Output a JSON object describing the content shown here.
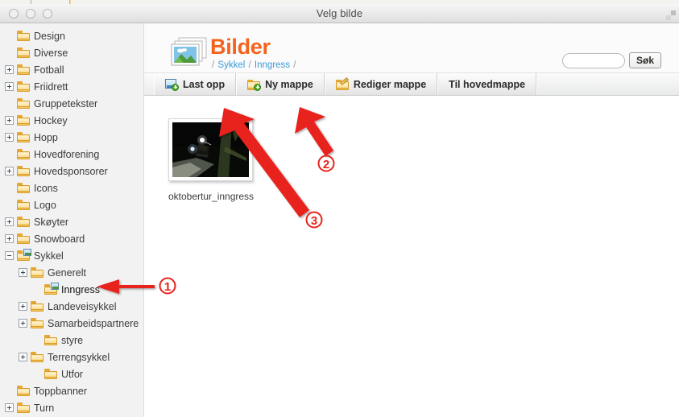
{
  "window": {
    "title": "Velg bilde",
    "controls": [
      "close",
      "minimize",
      "zoom"
    ],
    "resize_grip_icon": "resize-grip-icon"
  },
  "sidebar": {
    "items": [
      {
        "label": "Design",
        "indent": 1,
        "toggle": "none",
        "icon": "folder-icon"
      },
      {
        "label": "Diverse",
        "indent": 1,
        "toggle": "none",
        "icon": "folder-icon"
      },
      {
        "label": "Fotball",
        "indent": 1,
        "toggle": "plus",
        "icon": "folder-icon"
      },
      {
        "label": "Friidrett",
        "indent": 1,
        "toggle": "plus",
        "icon": "folder-icon"
      },
      {
        "label": "Gruppetekster",
        "indent": 1,
        "toggle": "none",
        "icon": "folder-icon"
      },
      {
        "label": "Hockey",
        "indent": 1,
        "toggle": "plus",
        "icon": "folder-icon"
      },
      {
        "label": "Hopp",
        "indent": 1,
        "toggle": "plus",
        "icon": "folder-icon"
      },
      {
        "label": "Hovedforening",
        "indent": 1,
        "toggle": "none",
        "icon": "folder-icon"
      },
      {
        "label": "Hovedsponsorer",
        "indent": 1,
        "toggle": "plus",
        "icon": "folder-icon"
      },
      {
        "label": "Icons",
        "indent": 1,
        "toggle": "none",
        "icon": "folder-icon"
      },
      {
        "label": "Logo",
        "indent": 1,
        "toggle": "none",
        "icon": "folder-icon"
      },
      {
        "label": "Skøyter",
        "indent": 1,
        "toggle": "plus",
        "icon": "folder-icon"
      },
      {
        "label": "Snowboard",
        "indent": 1,
        "toggle": "plus",
        "icon": "folder-icon"
      },
      {
        "label": "Sykkel",
        "indent": 1,
        "toggle": "minus",
        "icon": "folder-image-icon"
      },
      {
        "label": "Generelt",
        "indent": 2,
        "toggle": "plus",
        "icon": "folder-icon"
      },
      {
        "label": "Inngress",
        "indent": 3,
        "toggle": "none",
        "icon": "folder-image-icon",
        "selected": true
      },
      {
        "label": "Landeveisykkel",
        "indent": 2,
        "toggle": "plus",
        "icon": "folder-icon"
      },
      {
        "label": "Samarbeidspartnere",
        "indent": 2,
        "toggle": "plus",
        "icon": "folder-icon"
      },
      {
        "label": "styre",
        "indent": 3,
        "toggle": "none",
        "icon": "folder-icon"
      },
      {
        "label": "Terrengsykkel",
        "indent": 2,
        "toggle": "plus",
        "icon": "folder-icon"
      },
      {
        "label": "Utfor",
        "indent": 3,
        "toggle": "none",
        "icon": "folder-icon"
      },
      {
        "label": "Toppbanner",
        "indent": 1,
        "toggle": "none",
        "icon": "folder-icon"
      },
      {
        "label": "Turn",
        "indent": 1,
        "toggle": "plus",
        "icon": "folder-icon"
      }
    ]
  },
  "header": {
    "title": "Bilder",
    "title_color": "#f4631e",
    "icon": "pictures-icon",
    "breadcrumb": {
      "sep": "/",
      "crumbs": [
        "Sykkel",
        "Inngress"
      ],
      "link_color": "#3c9ad6"
    },
    "search": {
      "value": "",
      "placeholder": "",
      "button_label": "Søk"
    }
  },
  "toolbar": {
    "buttons": [
      {
        "label": "Last opp",
        "icon": "upload-image-icon"
      },
      {
        "label": "Ny mappe",
        "icon": "new-folder-icon"
      },
      {
        "label": "Rediger mappe",
        "icon": "edit-folder-icon"
      },
      {
        "label": "Til hovedmappe",
        "icon": "none"
      }
    ]
  },
  "files": [
    {
      "name": "oktobertur_inngress",
      "thumbnail": "night-mountain-biker-photo"
    }
  ],
  "annotations": [
    {
      "id": "1",
      "number": "1",
      "target": "sidebar-item-inngress"
    },
    {
      "id": "2",
      "number": "2",
      "target": "toolbar-button-ny-mappe"
    },
    {
      "id": "3",
      "number": "3",
      "target": "toolbar-button-last-opp"
    }
  ],
  "annotation_color": "#e01b1b"
}
